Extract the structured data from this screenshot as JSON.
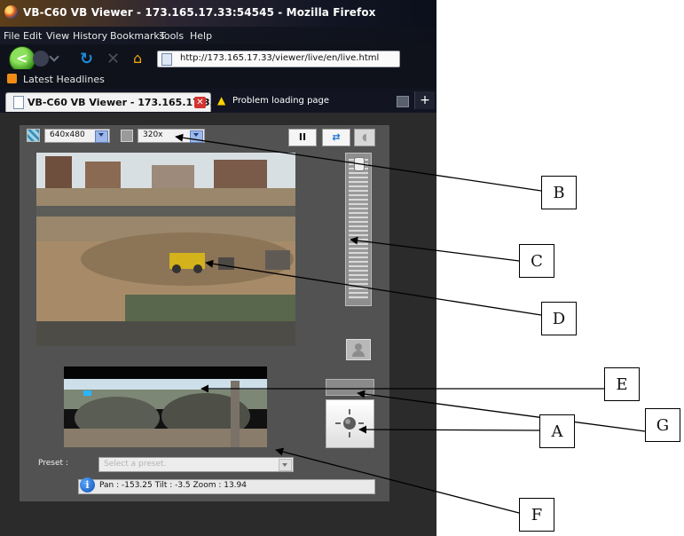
{
  "browser": {
    "window_title": "VB-C60 VB Viewer - 173.165.17.33:54545 - Mozilla Firefox",
    "menu": [
      "File",
      "Edit",
      "View",
      "History",
      "Bookmarks",
      "Tools",
      "Help"
    ],
    "url": "http://173.165.17.33/viewer/live/en/live.html",
    "bookmark": "Latest Headlines",
    "tabs": [
      {
        "label": "VB-C60 VB Viewer - 173.165.17.3...",
        "active": true
      },
      {
        "label": "Problem loading page",
        "active": false
      }
    ]
  },
  "viewer": {
    "video_size": "640x480",
    "display_size": "320x",
    "pause_icon": "II",
    "swap_icon": "⇄",
    "preset_label": "Preset :",
    "preset_placeholder": "Select a preset.",
    "status": "Pan : -153.25 Tilt : -3.5 Zoom : 13.94"
  },
  "callouts": [
    "A",
    "B",
    "C",
    "D",
    "E",
    "F",
    "G"
  ],
  "colors": {
    "viewer_bg": "#525252",
    "page_bg": "#2b2b2b",
    "accent_blue": "#9db8e8"
  }
}
